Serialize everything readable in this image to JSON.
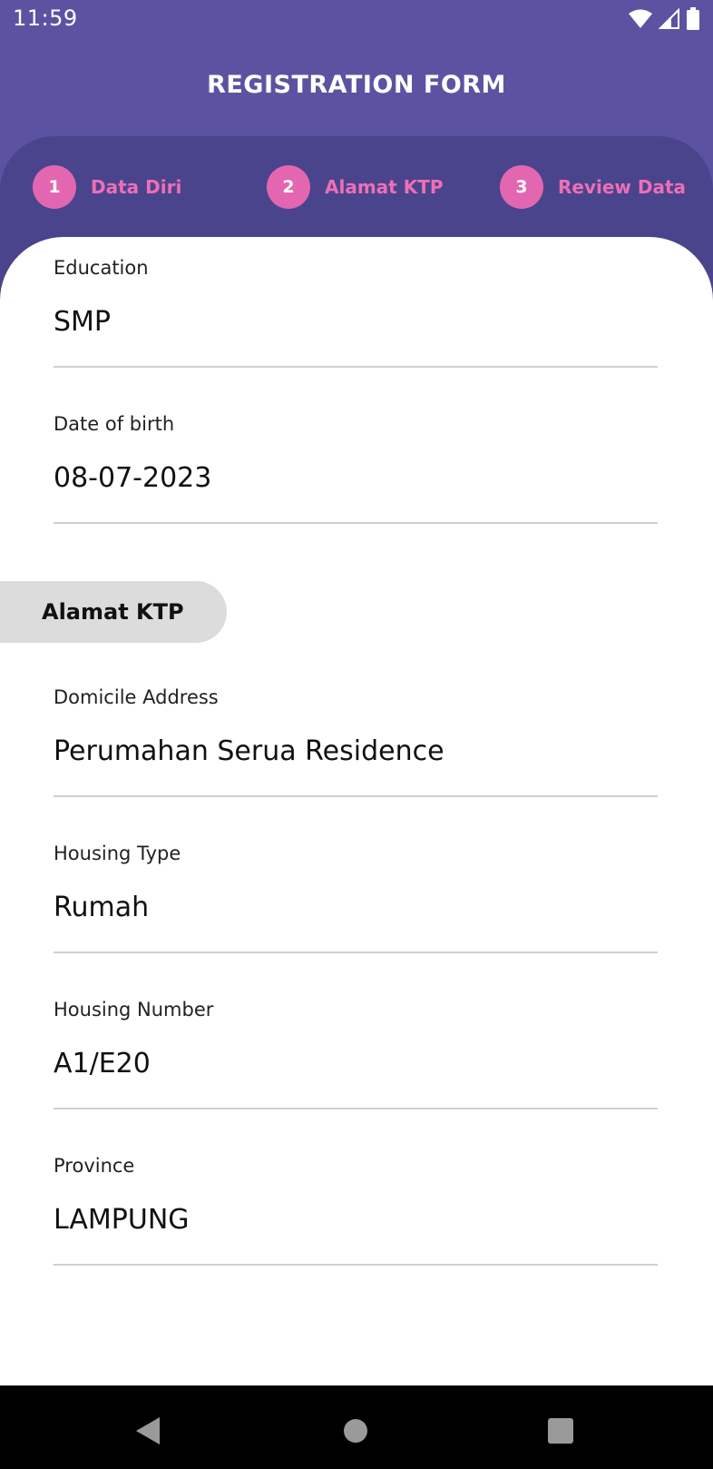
{
  "status_bar": {
    "time": "11:59",
    "icons": [
      "wifi-icon",
      "signal-icon",
      "battery-icon"
    ]
  },
  "header": {
    "title": "REGISTRATION FORM"
  },
  "stepper": {
    "steps": [
      {
        "number": "1",
        "label": "Data Diri"
      },
      {
        "number": "2",
        "label": "Alamat KTP"
      },
      {
        "number": "3",
        "label": "Review Data"
      }
    ]
  },
  "form": {
    "education": {
      "label": "Education",
      "value": "SMP"
    },
    "dob": {
      "label": "Date of birth",
      "value": "08-07-2023"
    },
    "section_title": "Alamat KTP",
    "domicile": {
      "label": "Domicile Address",
      "value": "Perumahan Serua Residence"
    },
    "housing_type": {
      "label": "Housing Type",
      "value": "Rumah"
    },
    "housing_number": {
      "label": "Housing Number",
      "value": "A1/E20"
    },
    "province": {
      "label": "Province",
      "value": "LAMPUNG"
    }
  },
  "nav_bar": {
    "buttons": [
      "back-icon",
      "home-icon",
      "recent-apps-icon"
    ]
  },
  "colors": {
    "header_bg": "#5b53a2",
    "stepper_bg": "#4a448c",
    "step_accent": "#e367b0",
    "section_chip_bg": "#dcdcdc"
  }
}
